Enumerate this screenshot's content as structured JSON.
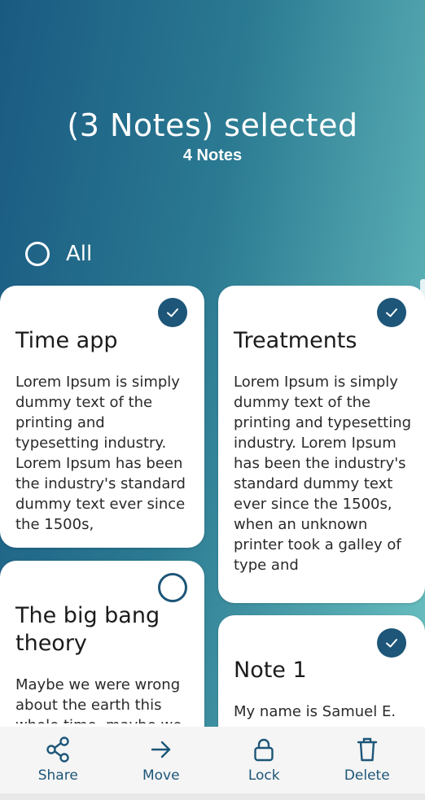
{
  "header": {
    "title": "(3 Notes) selected",
    "subtitle": "4 Notes"
  },
  "select_all": {
    "label": "All",
    "checked": false
  },
  "notes": [
    {
      "title": "Time app",
      "body": "Lorem Ipsum is simply dummy text of the printing and typesetting industry. Lorem Ipsum has been the industry's standard dummy text ever since the 1500s,",
      "selected": true
    },
    {
      "title": "Treatments",
      "body": "Lorem Ipsum is simply dummy text of the printing and typesetting industry. Lorem Ipsum has been the industry's standard dummy text ever since the 1500s, when an unknown printer took a galley of type and",
      "selected": true
    },
    {
      "title": "The big bang theory",
      "body": "Maybe we were wrong about the earth this whole time, maybe we",
      "selected": false
    },
    {
      "title": "Note 1",
      "body": "My name is Samuel E. A...",
      "selected": true
    }
  ],
  "actions": {
    "share": "Share",
    "move": "Move",
    "lock": "Lock",
    "delete": "Delete"
  },
  "colors": {
    "accent": "#1d5678",
    "gradient_start": "#1a5a82",
    "gradient_end": "#6cc3c2"
  }
}
